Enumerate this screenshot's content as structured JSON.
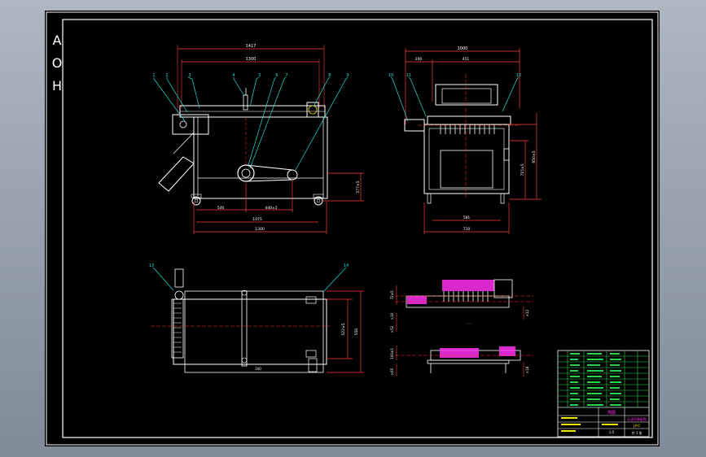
{
  "sheet": {
    "side_letters": [
      "A",
      "O",
      "H"
    ],
    "balloons": {
      "front": [
        "1",
        "2",
        "3",
        "4",
        "5",
        "6",
        "7",
        "8",
        "9"
      ],
      "side": [
        "10",
        "11",
        "12"
      ],
      "top": [
        "13",
        "14"
      ]
    },
    "front_view": {
      "dim_top_overall": "1417",
      "dim_top_inner": "1300",
      "dim_bottom_a": "500",
      "dim_bottom_b": "440±5",
      "dim_bottom_c": "1075",
      "dim_bottom_overall": "1300",
      "dim_right_height": "577±5"
    },
    "side_view": {
      "dim_top_overall": "1000",
      "dim_top_left": "200",
      "dim_top_right": "451",
      "dim_right_a": "715±5",
      "dim_right_b": "850±5",
      "dim_bottom_inner": "581",
      "dim_bottom_overall": "710"
    },
    "top_view": {
      "dim_right_inner": "522±5",
      "dim_right_outer": "550",
      "dim_bottom_note": "100"
    },
    "detail_views": {
      "left_dims": [
        "72±5",
        "×10",
        "×52",
        "100±5",
        "×65"
      ],
      "right_dims": [
        "×12",
        "×18"
      ],
      "caption": "一一"
    },
    "title_block": {
      "title": "简图",
      "part_name": "压滤机装配图",
      "drawing_no": "JX-0",
      "scale": "1:5",
      "sheet_count": "共 1 张"
    },
    "colors": {
      "frame": "#ffffff",
      "outline": "#ffffff",
      "dim": "#ff3b3b",
      "leader": "#1ee0d8",
      "center": "#ff3030",
      "hatch": "#ff2ff0",
      "green": "#2bd24b",
      "yellow": "#f2e600"
    }
  }
}
